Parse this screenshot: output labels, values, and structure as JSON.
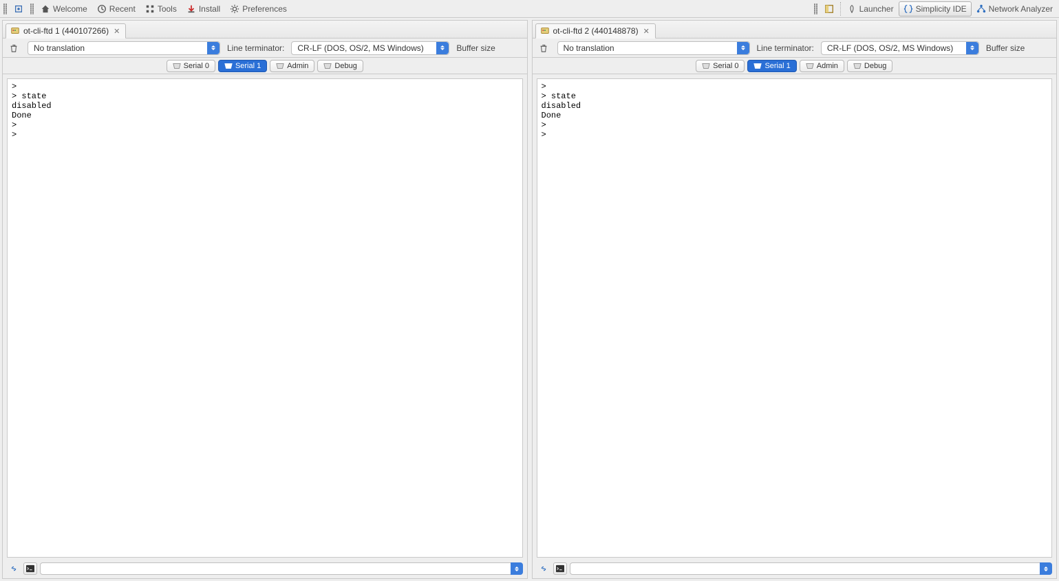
{
  "toolbar": {
    "welcome": "Welcome",
    "recent": "Recent",
    "tools": "Tools",
    "install": "Install",
    "preferences": "Preferences",
    "launcher": "Launcher",
    "simplicity_ide": "Simplicity IDE",
    "network_analyzer": "Network Analyzer"
  },
  "panes": [
    {
      "tab_title": "ot-cli-ftd 1 (440107266)",
      "translation_value": "No translation",
      "lineterm_label": "Line terminator:",
      "lineterm_value": "CR-LF  (DOS, OS/2, MS Windows)",
      "buffer_label": "Buffer size",
      "subtabs": [
        "Serial 0",
        "Serial 1",
        "Admin",
        "Debug"
      ],
      "subtab_active": 1,
      "console": "> \n> state\ndisabled\nDone\n> \n> "
    },
    {
      "tab_title": "ot-cli-ftd 2 (440148878)",
      "translation_value": "No translation",
      "lineterm_label": "Line terminator:",
      "lineterm_value": "CR-LF  (DOS, OS/2, MS Windows)",
      "buffer_label": "Buffer size",
      "subtabs": [
        "Serial 0",
        "Serial 1",
        "Admin",
        "Debug"
      ],
      "subtab_active": 1,
      "console": "> \n> state\ndisabled\nDone\n> \n> "
    }
  ]
}
